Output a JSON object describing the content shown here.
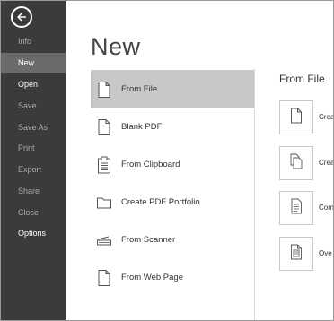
{
  "sidebar": {
    "items": [
      {
        "label": "Info",
        "state": "dim"
      },
      {
        "label": "New",
        "state": "selected"
      },
      {
        "label": "Open",
        "state": "bright"
      },
      {
        "label": "Save",
        "state": "dim"
      },
      {
        "label": "Save As",
        "state": "dim"
      },
      {
        "label": "Print",
        "state": "dim"
      },
      {
        "label": "Export",
        "state": "dim"
      },
      {
        "label": "Share",
        "state": "dim"
      },
      {
        "label": "Close",
        "state": "dim"
      },
      {
        "label": "Options",
        "state": "bright"
      }
    ]
  },
  "main": {
    "title": "New",
    "options": [
      {
        "label": "From File",
        "icon": "document-icon",
        "selected": true
      },
      {
        "label": "Blank PDF",
        "icon": "blank-page-icon",
        "selected": false
      },
      {
        "label": "From Clipboard",
        "icon": "clipboard-icon",
        "selected": false
      },
      {
        "label": "Create PDF Portfolio",
        "icon": "folder-icon",
        "selected": false
      },
      {
        "label": "From Scanner",
        "icon": "scanner-icon",
        "selected": false
      },
      {
        "label": "From Web Page",
        "icon": "web-page-icon",
        "selected": false
      }
    ]
  },
  "right_panel": {
    "title": "From File",
    "tiles": [
      {
        "label": "Crea",
        "icon": "single-page-icon"
      },
      {
        "label": "Crea",
        "icon": "stacked-pages-icon"
      },
      {
        "label": "Com",
        "icon": "combine-files-icon"
      },
      {
        "label": "Ove",
        "icon": "overlay-pages-icon"
      }
    ]
  }
}
